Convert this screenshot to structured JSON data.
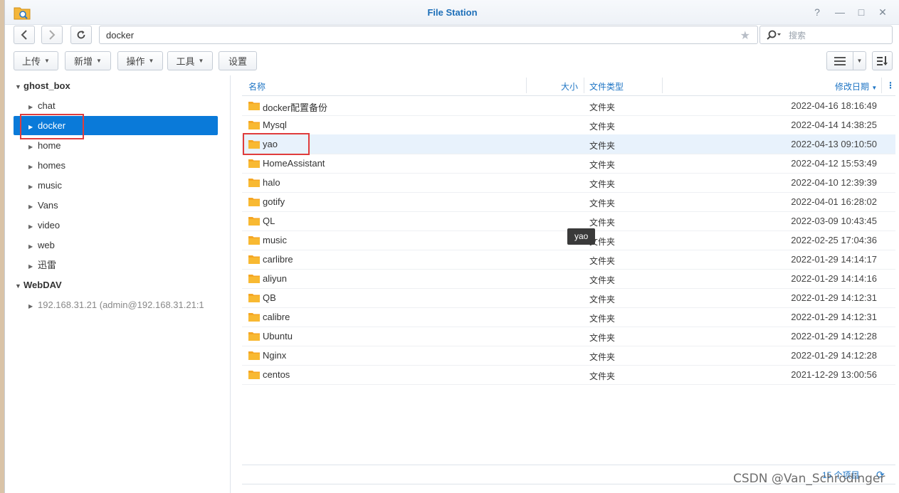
{
  "window": {
    "title": "File Station"
  },
  "window_controls": {
    "help": "?",
    "minimize": "—",
    "maximize": "□",
    "close": "✕"
  },
  "address": {
    "path": "docker"
  },
  "search": {
    "placeholder": "搜索"
  },
  "toolbar": {
    "upload": "上传",
    "create": "新增",
    "action": "操作",
    "tools": "工具",
    "settings": "设置"
  },
  "sidebar": {
    "root1": "ghost_box",
    "items": [
      {
        "label": "chat"
      },
      {
        "label": "docker"
      },
      {
        "label": "home"
      },
      {
        "label": "homes"
      },
      {
        "label": "music"
      },
      {
        "label": "Vans"
      },
      {
        "label": "video"
      },
      {
        "label": "web"
      },
      {
        "label": "迅雷"
      }
    ],
    "root2": "WebDAV",
    "webdav_item": "192.168.31.21 (admin@192.168.31.21:1"
  },
  "columns": {
    "name": "名称",
    "size": "大小",
    "type": "文件类型",
    "modified": "修改日期"
  },
  "files": [
    {
      "name": "docker配置备份",
      "type": "文件夹",
      "modified": "2022-04-16 18:16:49"
    },
    {
      "name": "Mysql",
      "type": "文件夹",
      "modified": "2022-04-14 14:38:25"
    },
    {
      "name": "yao",
      "type": "文件夹",
      "modified": "2022-04-13 09:10:50"
    },
    {
      "name": "HomeAssistant",
      "type": "文件夹",
      "modified": "2022-04-12 15:53:49"
    },
    {
      "name": "halo",
      "type": "文件夹",
      "modified": "2022-04-10 12:39:39"
    },
    {
      "name": "gotify",
      "type": "文件夹",
      "modified": "2022-04-01 16:28:02"
    },
    {
      "name": "QL",
      "type": "文件夹",
      "modified": "2022-03-09 10:43:45"
    },
    {
      "name": "music",
      "type": "文件夹",
      "modified": "2022-02-25 17:04:36"
    },
    {
      "name": "carlibre",
      "type": "文件夹",
      "modified": "2022-01-29 14:14:17"
    },
    {
      "name": "aliyun",
      "type": "文件夹",
      "modified": "2022-01-29 14:14:16"
    },
    {
      "name": "QB",
      "type": "文件夹",
      "modified": "2022-01-29 14:12:31"
    },
    {
      "name": "calibre",
      "type": "文件夹",
      "modified": "2022-01-29 14:12:31"
    },
    {
      "name": "Ubuntu",
      "type": "文件夹",
      "modified": "2022-01-29 14:12:28"
    },
    {
      "name": "Nginx",
      "type": "文件夹",
      "modified": "2022-01-29 14:12:28"
    },
    {
      "name": "centos",
      "type": "文件夹",
      "modified": "2021-12-29 13:00:56"
    }
  ],
  "tooltip": "yao",
  "status": {
    "count": "15 个项目"
  },
  "watermark": "CSDN @Van_Schrodinger",
  "colors": {
    "accent": "#0a7ad9",
    "folder": "#f5a623",
    "highlight_box": "#e03c3c"
  }
}
